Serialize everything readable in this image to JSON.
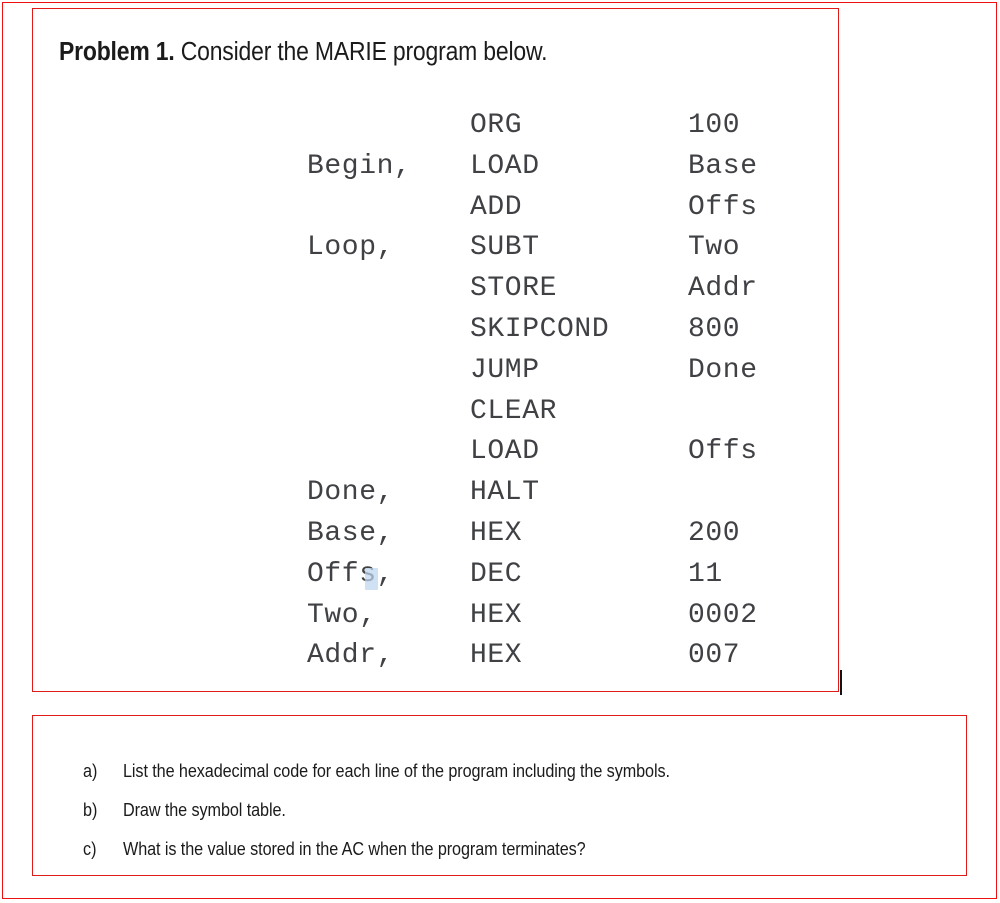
{
  "colors": {
    "frame_red": "#ee1111",
    "box_red": "#e01b18",
    "code_text": "#3f4144",
    "body_text": "#1b1b1b",
    "selection_blue": "#bcd6ef"
  },
  "problem": {
    "title_strong": "Problem 1.",
    "title_rest": " Consider the MARIE program below.",
    "code": [
      {
        "label": "",
        "opcode": "ORG",
        "operand": "100"
      },
      {
        "label": "Begin,",
        "opcode": "LOAD",
        "operand": "Base"
      },
      {
        "label": "",
        "opcode": "ADD",
        "operand": "Offs"
      },
      {
        "label": "Loop,",
        "opcode": "SUBT",
        "operand": "Two"
      },
      {
        "label": "",
        "opcode": "STORE",
        "operand": "Addr"
      },
      {
        "label": "",
        "opcode": "SKIPCOND",
        "operand": "800"
      },
      {
        "label": "",
        "opcode": "JUMP",
        "operand": "Done"
      },
      {
        "label": "",
        "opcode": "CLEAR",
        "operand": ""
      },
      {
        "label": "",
        "opcode": "LOAD",
        "operand": "Offs"
      },
      {
        "label": "Done,",
        "opcode": "HALT",
        "operand": ""
      },
      {
        "label": "Base,",
        "opcode": "HEX",
        "operand": "200"
      },
      {
        "label": "Offs,",
        "opcode": "DEC",
        "operand": "11"
      },
      {
        "label": "Two,",
        "opcode": "HEX",
        "operand": "0002"
      },
      {
        "label": "Addr,",
        "opcode": "HEX",
        "operand": "007"
      }
    ]
  },
  "questions": [
    {
      "marker": "a)",
      "text": "List the hexadecimal code for each line of the program including the symbols."
    },
    {
      "marker": "b)",
      "text": "Draw the symbol table."
    },
    {
      "marker": "c)",
      "text": "What is the value stored in the AC when the program terminates?"
    }
  ]
}
